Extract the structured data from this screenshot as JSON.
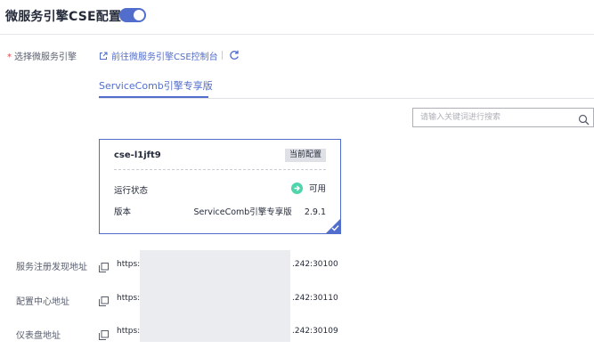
{
  "header": {
    "title": "微服务引擎CSE配置",
    "toggle_on": true
  },
  "engine": {
    "required_label": "选择微服务引擎",
    "goto_console_link": "前往微服务引擎CSE控制台",
    "tabs": [
      {
        "label": "ServiceComb引擎专享版",
        "active": true
      }
    ]
  },
  "search": {
    "placeholder": "请输入关键词进行搜索",
    "value": ""
  },
  "card": {
    "name": "cse-l1jft9",
    "badge": "当前配置",
    "status_label": "运行状态",
    "status_value": "可用",
    "version_label": "版本",
    "version_edition": "ServiceComb引擎专享版",
    "version_number": "2.9.1",
    "selected": true
  },
  "addresses": [
    {
      "label": "服务注册发现地址",
      "prefix": "https://",
      "suffix": ".242:30100"
    },
    {
      "label": "配置中心地址",
      "prefix": "https://",
      "suffix": ".242:30110"
    },
    {
      "label": "仪表盘地址",
      "prefix": "https://",
      "suffix": ".242:30109"
    }
  ],
  "colors": {
    "accent": "#526ecc",
    "status_ok": "#50d4ab",
    "required": "#e54545",
    "mask": "#ebecef"
  },
  "icons": [
    "external-link-icon",
    "refresh-icon",
    "search-icon",
    "check-circle-icon",
    "checkmark-icon",
    "copy-icon"
  ]
}
